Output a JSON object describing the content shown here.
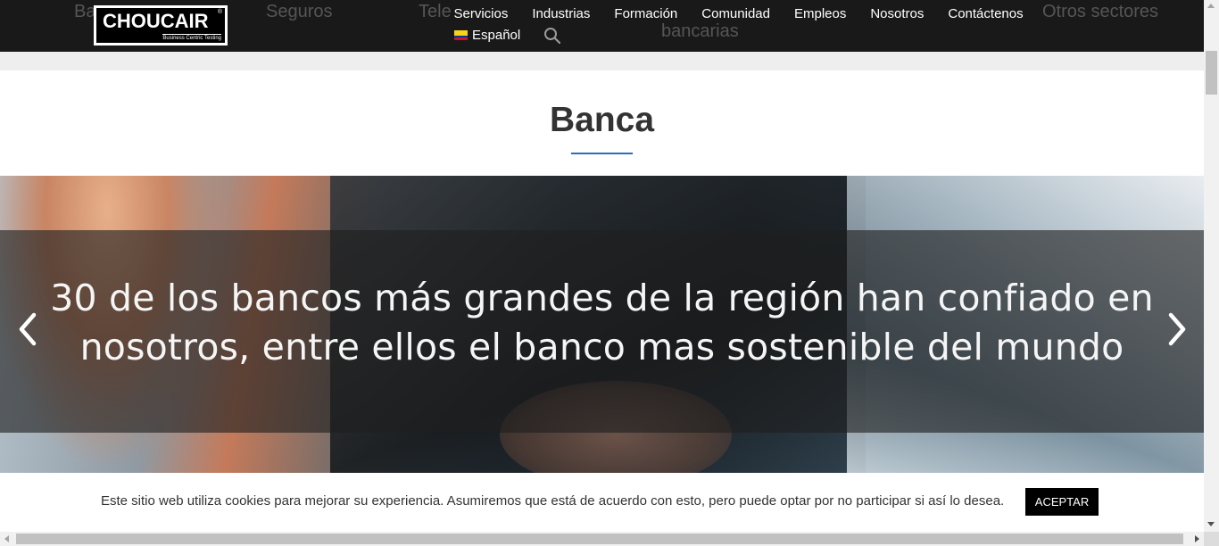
{
  "header": {
    "logo_text": "CHOUCAIR",
    "logo_registered": "®",
    "logo_tagline": "Business Centric Testing",
    "behind_tabs": [
      "Ba",
      "Seguros",
      "Tele",
      "bancarias",
      "Otros sectores"
    ],
    "nav": [
      "Servicios",
      "Industrias",
      "Formación",
      "Comunidad",
      "Empleos",
      "Nosotros",
      "Contáctenos"
    ],
    "language": "Español",
    "search_icon": "search-icon"
  },
  "section": {
    "title": "Banca",
    "accent_color": "#2a6fbb"
  },
  "hero": {
    "text": "30 de los bancos más grandes de la región han confiado en nosotros, entre ellos el banco mas sostenible del mundo",
    "prev_icon": "chevron-left-icon",
    "next_icon": "chevron-right-icon"
  },
  "cookie": {
    "text": "Este sitio web utiliza cookies para mejorar su experiencia. Asumiremos que está de acuerdo con esto, pero puede optar por no participar si así lo desea.",
    "button": "ACEPTAR"
  }
}
